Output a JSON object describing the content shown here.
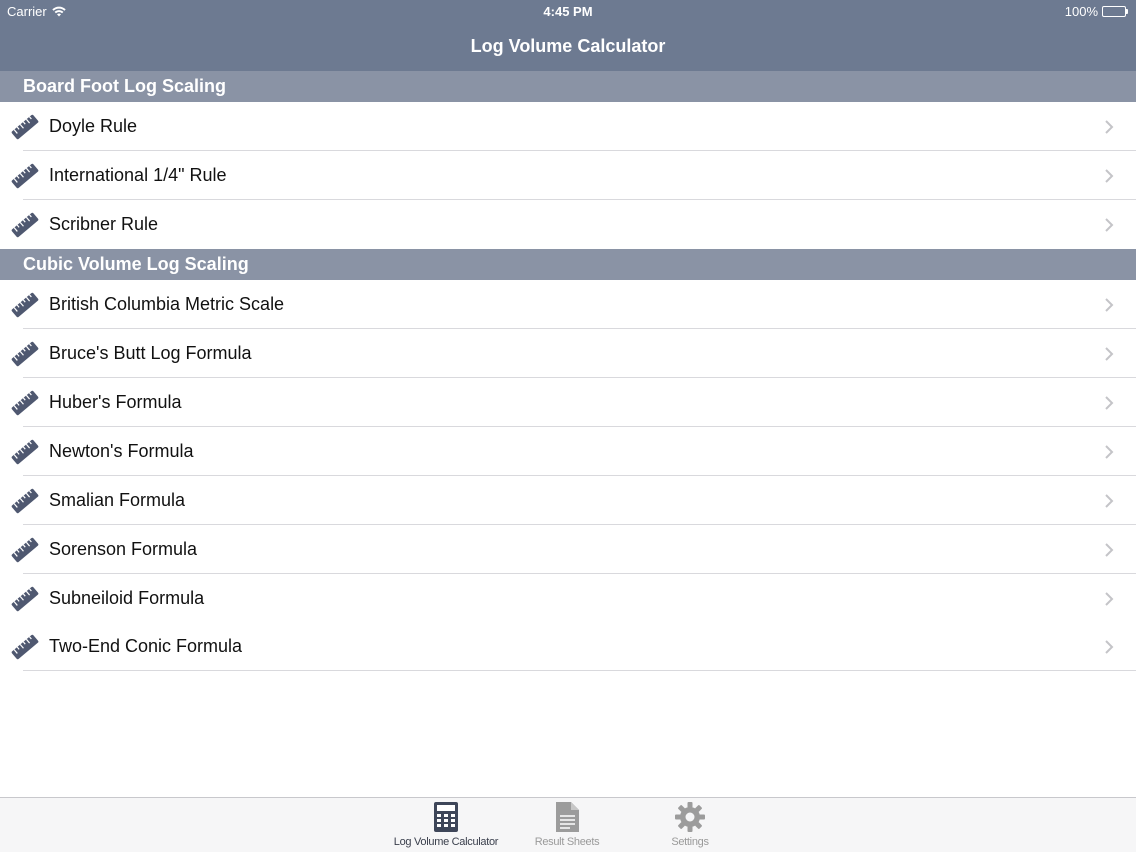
{
  "status_bar": {
    "carrier": "Carrier",
    "time": "4:45 PM",
    "battery": "100%"
  },
  "nav": {
    "title": "Log Volume Calculator"
  },
  "sections": [
    {
      "header": "Board Foot Log Scaling",
      "items": [
        {
          "label": "Doyle Rule"
        },
        {
          "label": "International 1/4\" Rule"
        },
        {
          "label": "Scribner Rule"
        }
      ]
    },
    {
      "header": "Cubic Volume Log Scaling",
      "items": [
        {
          "label": "British Columbia Metric Scale"
        },
        {
          "label": "Bruce's Butt Log Formula"
        },
        {
          "label": "Huber's Formula"
        },
        {
          "label": "Newton's Formula"
        },
        {
          "label": "Smalian Formula"
        },
        {
          "label": "Sorenson Formula"
        },
        {
          "label": "Subneiloid Formula"
        },
        {
          "label": "Two-End Conic Formula"
        }
      ]
    }
  ],
  "tabbar": {
    "tabs": [
      {
        "label": "Log Volume Calculator",
        "icon": "calculator-icon",
        "active": true
      },
      {
        "label": "Result Sheets",
        "icon": "document-icon",
        "active": false
      },
      {
        "label": "Settings",
        "icon": "gear-icon",
        "active": false
      }
    ]
  },
  "colors": {
    "nav_background": "#6d7a91",
    "section_header_background": "#8a93a5",
    "icon_color": "#4f5870",
    "tab_active": "#3a3f4c",
    "tab_inactive": "#9a9a9a"
  }
}
